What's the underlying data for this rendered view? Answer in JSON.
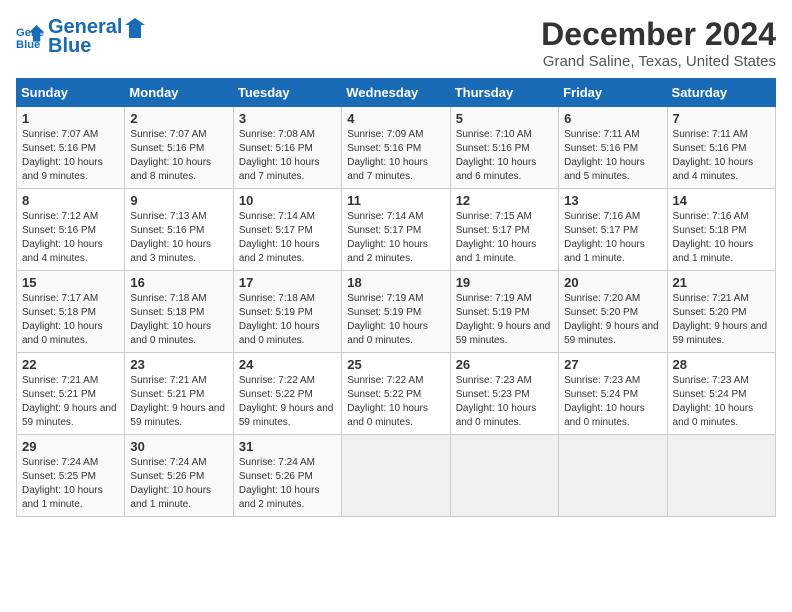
{
  "header": {
    "logo_line1": "General",
    "logo_line2": "Blue",
    "month_title": "December 2024",
    "location": "Grand Saline, Texas, United States"
  },
  "days_of_week": [
    "Sunday",
    "Monday",
    "Tuesday",
    "Wednesday",
    "Thursday",
    "Friday",
    "Saturday"
  ],
  "weeks": [
    [
      {
        "num": "1",
        "sunrise": "7:07 AM",
        "sunset": "5:16 PM",
        "daylight": "10 hours and 9 minutes."
      },
      {
        "num": "2",
        "sunrise": "7:07 AM",
        "sunset": "5:16 PM",
        "daylight": "10 hours and 8 minutes."
      },
      {
        "num": "3",
        "sunrise": "7:08 AM",
        "sunset": "5:16 PM",
        "daylight": "10 hours and 7 minutes."
      },
      {
        "num": "4",
        "sunrise": "7:09 AM",
        "sunset": "5:16 PM",
        "daylight": "10 hours and 7 minutes."
      },
      {
        "num": "5",
        "sunrise": "7:10 AM",
        "sunset": "5:16 PM",
        "daylight": "10 hours and 6 minutes."
      },
      {
        "num": "6",
        "sunrise": "7:11 AM",
        "sunset": "5:16 PM",
        "daylight": "10 hours and 5 minutes."
      },
      {
        "num": "7",
        "sunrise": "7:11 AM",
        "sunset": "5:16 PM",
        "daylight": "10 hours and 4 minutes."
      }
    ],
    [
      {
        "num": "8",
        "sunrise": "7:12 AM",
        "sunset": "5:16 PM",
        "daylight": "10 hours and 4 minutes."
      },
      {
        "num": "9",
        "sunrise": "7:13 AM",
        "sunset": "5:16 PM",
        "daylight": "10 hours and 3 minutes."
      },
      {
        "num": "10",
        "sunrise": "7:14 AM",
        "sunset": "5:17 PM",
        "daylight": "10 hours and 2 minutes."
      },
      {
        "num": "11",
        "sunrise": "7:14 AM",
        "sunset": "5:17 PM",
        "daylight": "10 hours and 2 minutes."
      },
      {
        "num": "12",
        "sunrise": "7:15 AM",
        "sunset": "5:17 PM",
        "daylight": "10 hours and 1 minute."
      },
      {
        "num": "13",
        "sunrise": "7:16 AM",
        "sunset": "5:17 PM",
        "daylight": "10 hours and 1 minute."
      },
      {
        "num": "14",
        "sunrise": "7:16 AM",
        "sunset": "5:18 PM",
        "daylight": "10 hours and 1 minute."
      }
    ],
    [
      {
        "num": "15",
        "sunrise": "7:17 AM",
        "sunset": "5:18 PM",
        "daylight": "10 hours and 0 minutes."
      },
      {
        "num": "16",
        "sunrise": "7:18 AM",
        "sunset": "5:18 PM",
        "daylight": "10 hours and 0 minutes."
      },
      {
        "num": "17",
        "sunrise": "7:18 AM",
        "sunset": "5:19 PM",
        "daylight": "10 hours and 0 minutes."
      },
      {
        "num": "18",
        "sunrise": "7:19 AM",
        "sunset": "5:19 PM",
        "daylight": "10 hours and 0 minutes."
      },
      {
        "num": "19",
        "sunrise": "7:19 AM",
        "sunset": "5:19 PM",
        "daylight": "9 hours and 59 minutes."
      },
      {
        "num": "20",
        "sunrise": "7:20 AM",
        "sunset": "5:20 PM",
        "daylight": "9 hours and 59 minutes."
      },
      {
        "num": "21",
        "sunrise": "7:21 AM",
        "sunset": "5:20 PM",
        "daylight": "9 hours and 59 minutes."
      }
    ],
    [
      {
        "num": "22",
        "sunrise": "7:21 AM",
        "sunset": "5:21 PM",
        "daylight": "9 hours and 59 minutes."
      },
      {
        "num": "23",
        "sunrise": "7:21 AM",
        "sunset": "5:21 PM",
        "daylight": "9 hours and 59 minutes."
      },
      {
        "num": "24",
        "sunrise": "7:22 AM",
        "sunset": "5:22 PM",
        "daylight": "9 hours and 59 minutes."
      },
      {
        "num": "25",
        "sunrise": "7:22 AM",
        "sunset": "5:22 PM",
        "daylight": "10 hours and 0 minutes."
      },
      {
        "num": "26",
        "sunrise": "7:23 AM",
        "sunset": "5:23 PM",
        "daylight": "10 hours and 0 minutes."
      },
      {
        "num": "27",
        "sunrise": "7:23 AM",
        "sunset": "5:24 PM",
        "daylight": "10 hours and 0 minutes."
      },
      {
        "num": "28",
        "sunrise": "7:23 AM",
        "sunset": "5:24 PM",
        "daylight": "10 hours and 0 minutes."
      }
    ],
    [
      {
        "num": "29",
        "sunrise": "7:24 AM",
        "sunset": "5:25 PM",
        "daylight": "10 hours and 1 minute."
      },
      {
        "num": "30",
        "sunrise": "7:24 AM",
        "sunset": "5:26 PM",
        "daylight": "10 hours and 1 minute."
      },
      {
        "num": "31",
        "sunrise": "7:24 AM",
        "sunset": "5:26 PM",
        "daylight": "10 hours and 2 minutes."
      },
      null,
      null,
      null,
      null
    ]
  ]
}
